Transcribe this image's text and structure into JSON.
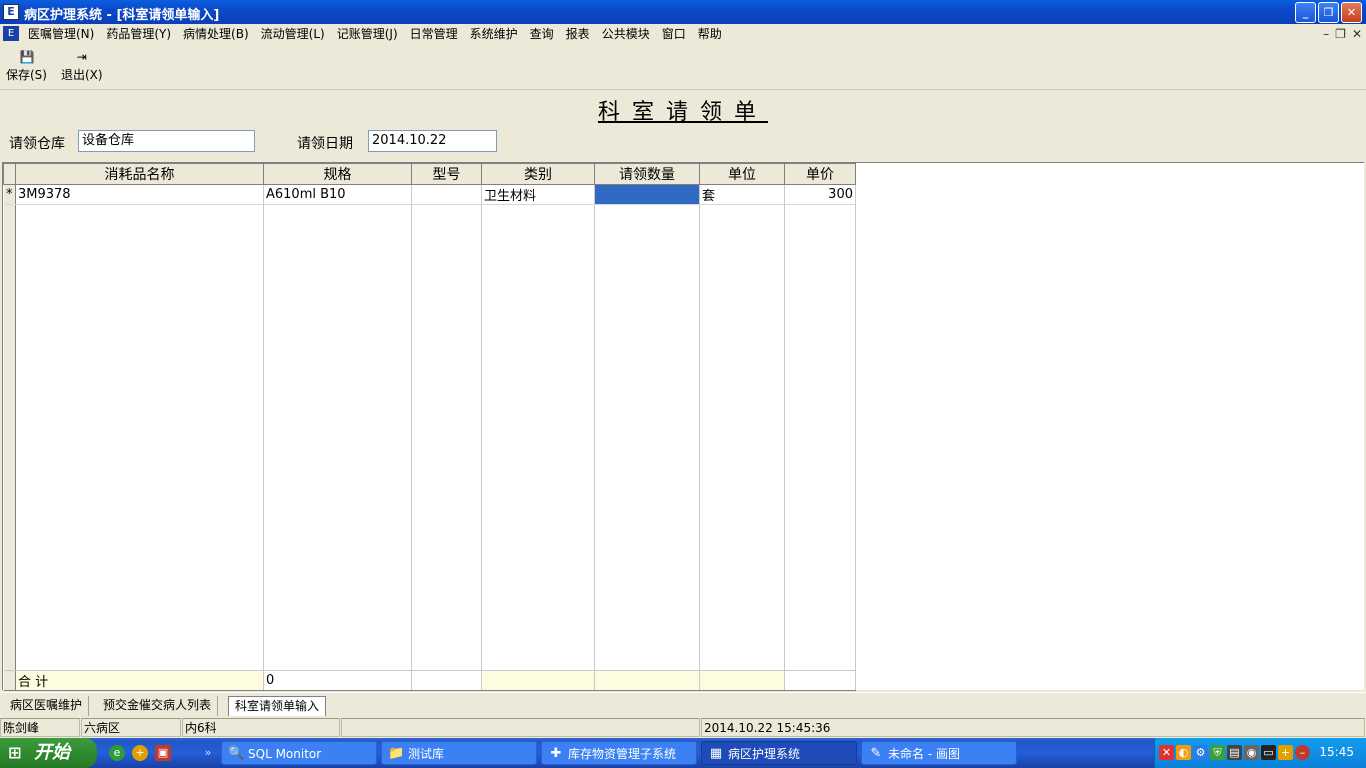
{
  "window": {
    "title": "病区护理系统 - [科室请领单输入]"
  },
  "menu": [
    "医嘱管理(N)",
    "药品管理(Y)",
    "病情处理(B)",
    "流动管理(L)",
    "记账管理(J)",
    "日常管理",
    "系统维护",
    "查询",
    "报表",
    "公共模块",
    "窗口",
    "帮助"
  ],
  "toolbar": {
    "save_label": "保存(S)",
    "exit_label": "退出(X)"
  },
  "form": {
    "title": "科室请领单",
    "warehouse_label": "请领仓库",
    "warehouse_value": "设备仓库",
    "date_label": "请领日期",
    "date_value": "2014.10.22"
  },
  "grid": {
    "headers": [
      "消耗品名称",
      "规格",
      "型号",
      "类别",
      "请领数量",
      "单位",
      "单价"
    ],
    "row": {
      "indicator": "*",
      "name": "3M9378",
      "spec": "A610ml B10",
      "model": "",
      "category": "卫生材料",
      "qty": "",
      "unit": "套",
      "price": "300"
    },
    "total_label": "合  计",
    "total_value": "0"
  },
  "tabs": [
    "病区医嘱维护",
    "预交金催交病人列表",
    "科室请领单输入"
  ],
  "status": {
    "user": "陈剑峰",
    "ward": "六病区",
    "dept": "内6科",
    "datetime": "2014.10.22 15:45:36"
  },
  "taskbar": {
    "start": "开始",
    "tasks": [
      "SQL Monitor",
      "测试库",
      "库存物资管理子系统",
      "病区护理系统",
      "未命名 - 画图"
    ],
    "clock": "15:45"
  }
}
